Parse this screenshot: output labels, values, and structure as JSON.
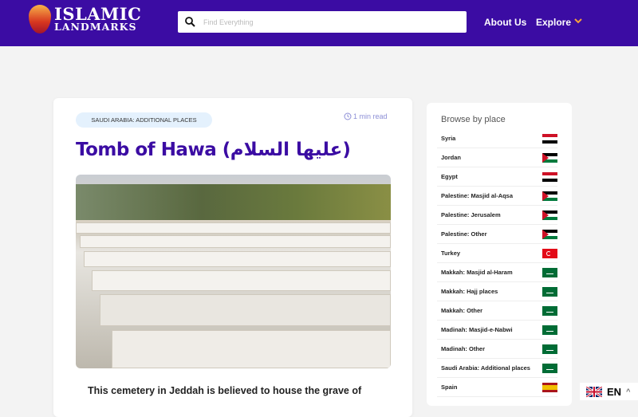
{
  "header": {
    "logo_line1": "ISLAMIC",
    "logo_line2": "LANDMARKS",
    "search_placeholder": "Find Everything",
    "nav": [
      {
        "label": "About Us"
      },
      {
        "label": "Explore"
      }
    ]
  },
  "article": {
    "category": "SAUDI ARABIA: ADDITIONAL PLACES",
    "read_time": "1 min read",
    "title": "Tomb of Hawa (عليها السلام)",
    "intro": "This cemetery in Jeddah is believed to house the grave of"
  },
  "sidebar": {
    "heading": "Browse by place",
    "items": [
      {
        "label": "Syria",
        "flag": "syria"
      },
      {
        "label": "Jordan",
        "flag": "jordan"
      },
      {
        "label": "Egypt",
        "flag": "egypt"
      },
      {
        "label": "Palestine: Masjid al-Aqsa",
        "flag": "palestine"
      },
      {
        "label": "Palestine: Jerusalem",
        "flag": "palestine"
      },
      {
        "label": "Palestine: Other",
        "flag": "palestine"
      },
      {
        "label": "Turkey",
        "flag": "turkey"
      },
      {
        "label": "Makkah: Masjid al-Haram",
        "flag": "saudi"
      },
      {
        "label": "Makkah: Hajj places",
        "flag": "saudi"
      },
      {
        "label": "Makkah: Other",
        "flag": "saudi"
      },
      {
        "label": "Madinah: Masjid-e-Nabwi",
        "flag": "saudi"
      },
      {
        "label": "Madinah: Other",
        "flag": "saudi"
      },
      {
        "label": "Saudi Arabia: Additional places",
        "flag": "saudi"
      },
      {
        "label": "Spain",
        "flag": "spain"
      }
    ]
  },
  "language": {
    "current": "EN"
  },
  "colors": {
    "brand": "#3b0ca3"
  }
}
